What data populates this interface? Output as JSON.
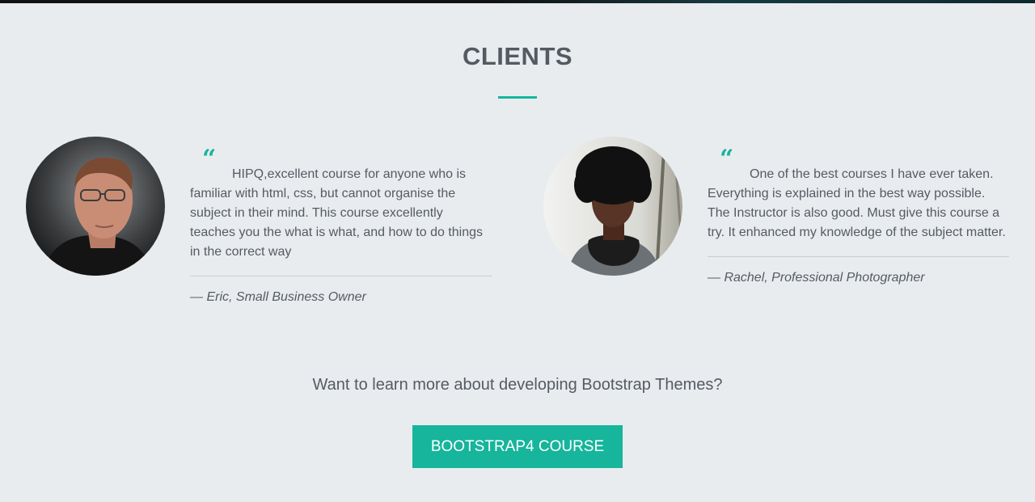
{
  "section": {
    "title": "CLIENTS"
  },
  "testimonials": [
    {
      "quote_icon": "“",
      "text": "HIPQ,excellent course for anyone who is familiar with html, css, but cannot organise the subject in their mind. This course excellently teaches you the what is what, and how to do things in the correct way",
      "author": "— Eric, Small Business Owner",
      "avatar": "avatar-photo-man-glasses"
    },
    {
      "quote_icon": "“",
      "text": "One of the best courses I have ever taken. Everything is explained in the best way possible. The Instructor is also good. Must give this course a try. It enhanced my knowledge of the subject matter.",
      "author": "— Rachel, Professional Photographer",
      "avatar": "avatar-photo-woman-scarf"
    }
  ],
  "cta": {
    "text": "Want to learn more about developing Bootstrap Themes?",
    "button_label": "BOOTSTRAP4 COURSE"
  },
  "colors": {
    "accent": "#16b59c",
    "background": "#e9ecef",
    "text": "#555b62"
  }
}
